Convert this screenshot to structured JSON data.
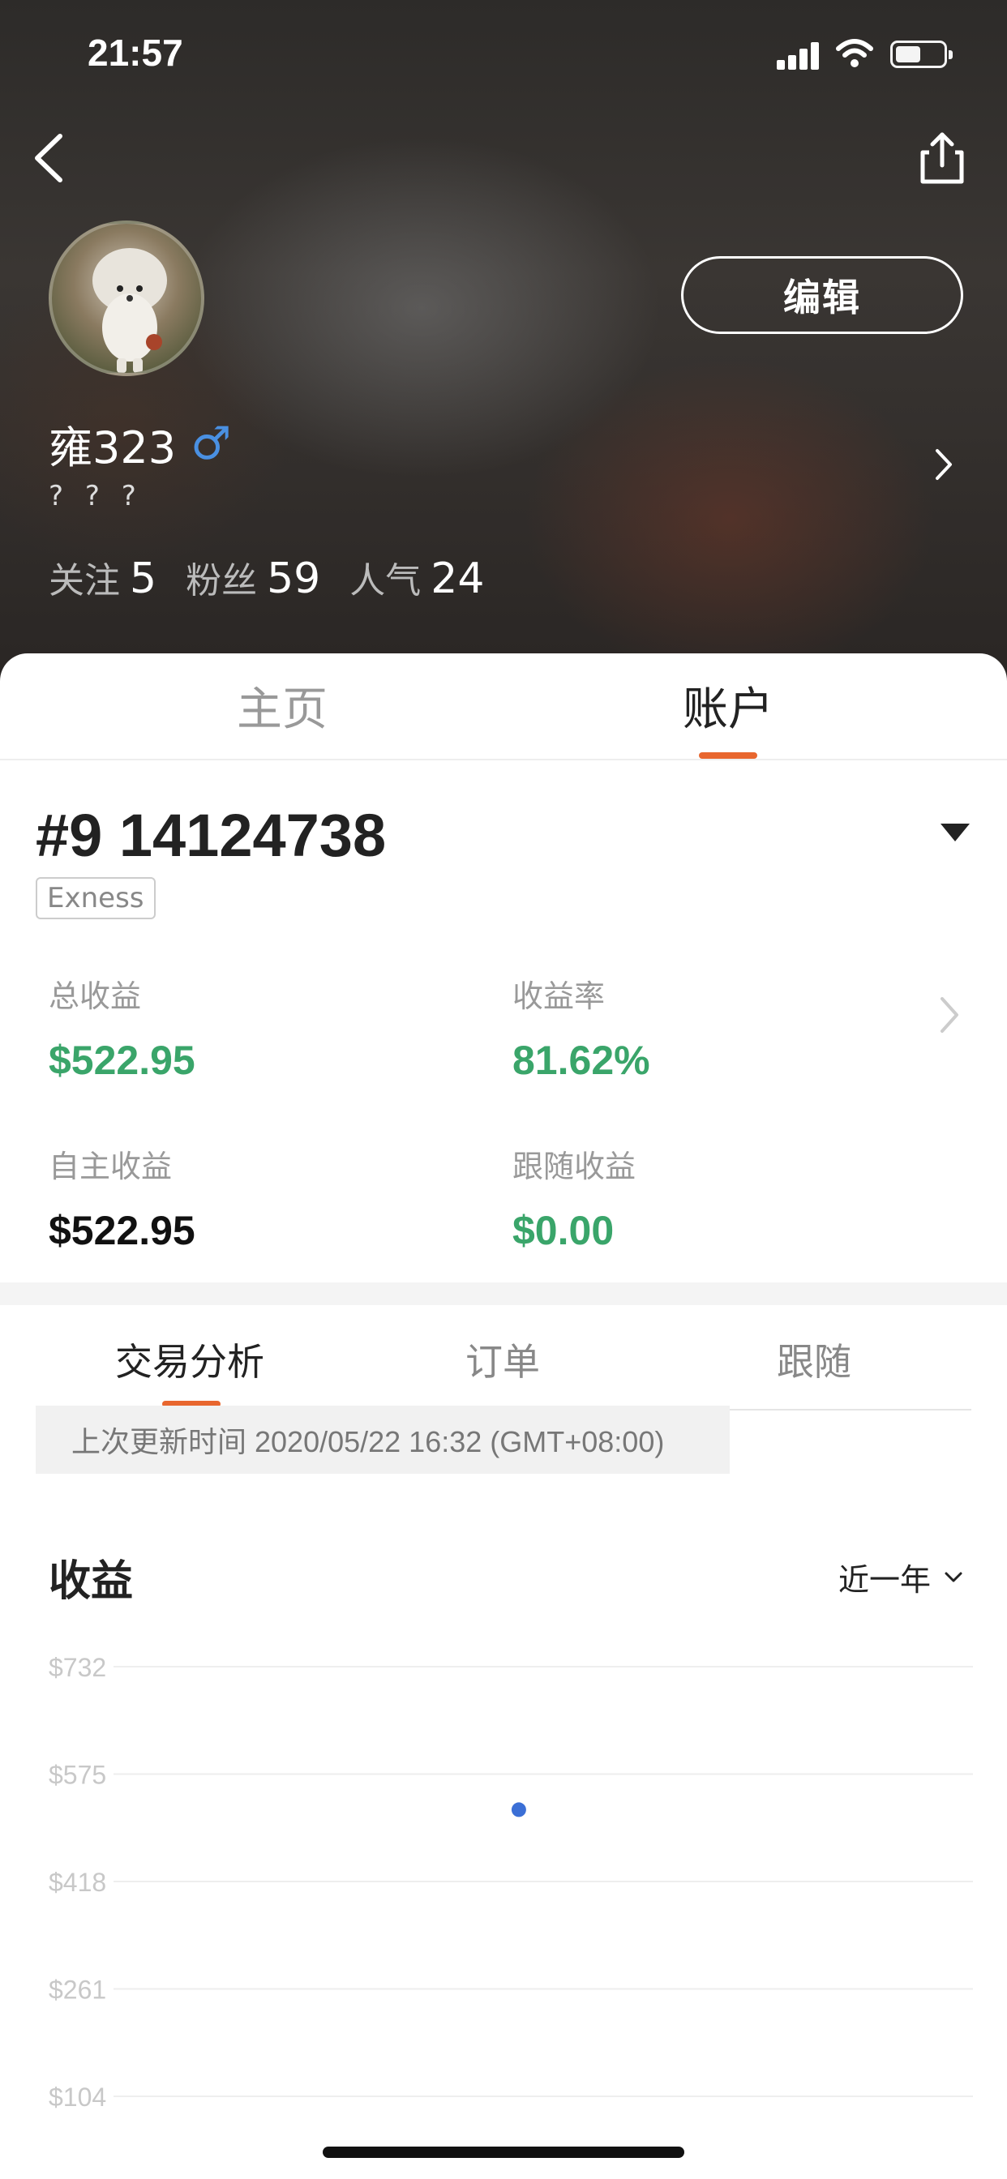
{
  "status_bar": {
    "time": "21:57"
  },
  "header": {
    "username": "雍323",
    "gender_symbol": "♂",
    "bio": "? ? ?",
    "edit_label": "编辑",
    "stats": [
      {
        "label": "关注",
        "value": "5"
      },
      {
        "label": "粉丝",
        "value": "59"
      },
      {
        "label": "人气",
        "value": "24"
      }
    ]
  },
  "main_tabs": [
    {
      "label": "主页",
      "active": false
    },
    {
      "label": "账户",
      "active": true
    }
  ],
  "account": {
    "id": "#9 14124738",
    "broker": "Exness",
    "metrics": {
      "total_profit": {
        "label": "总收益",
        "value": "$522.95"
      },
      "profit_rate": {
        "label": "收益率",
        "value": "81.62%"
      },
      "self_profit": {
        "label": "自主收益",
        "value": "$522.95"
      },
      "follow_profit": {
        "label": "跟随收益",
        "value": "$0.00"
      }
    }
  },
  "sub_tabs": [
    {
      "label": "交易分析",
      "active": true
    },
    {
      "label": "订单",
      "active": false
    },
    {
      "label": "跟随",
      "active": false
    }
  ],
  "update_text": "上次更新时间 2020/05/22 16:32 (GMT+08:00)",
  "section": {
    "title": "收益",
    "range_label": "近一年"
  },
  "colors": {
    "accent": "#e8662e",
    "profit_green": "#3aa56a",
    "gender_blue": "#4a90e2",
    "point_blue": "#3b6fd6"
  },
  "chart_data": {
    "type": "scatter",
    "y_ticks": [
      "$732",
      "$575",
      "$418",
      "$261",
      "$104"
    ],
    "ylim": [
      104,
      732
    ],
    "series": [
      {
        "values": [
          {
            "x": 0.5,
            "y": 522.95
          }
        ]
      }
    ],
    "grid": true
  }
}
